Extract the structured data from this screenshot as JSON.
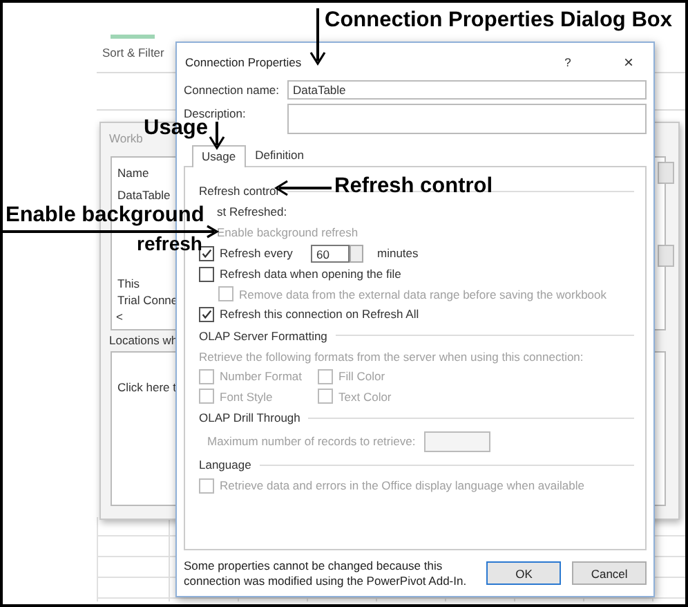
{
  "background": {
    "ribbon_label": "Sort & Filter"
  },
  "back_window": {
    "title": "Workb",
    "list_header": "Name",
    "list_items": [
      {
        "label": "DataTable"
      },
      {
        "label": "This"
      },
      {
        "label": "Trial Conne"
      }
    ],
    "scroll_left": "<",
    "locations_label": "Locations wh",
    "locations_row": "Click here t"
  },
  "dialog": {
    "title": "Connection Properties",
    "help": "?",
    "close": "×",
    "name_label": "Connection name:",
    "name_value": "DataTable",
    "description_label": "Description:",
    "tabs": [
      {
        "label": "Usage",
        "selected": true
      },
      {
        "label": "Definition",
        "selected": false
      }
    ],
    "rows": [
      {
        "kind": "section",
        "text": "Refresh control"
      },
      {
        "kind": "label",
        "text": "st Refreshed:",
        "disabled": false
      },
      {
        "kind": "label",
        "text": "Enable background refresh",
        "disabled": true
      },
      {
        "kind": "spin",
        "label": "Refresh every",
        "checked": true,
        "value": "60",
        "unit": "minutes"
      },
      {
        "kind": "checkbox",
        "label": "Refresh data when opening the file",
        "checked": false,
        "disabled": false,
        "indent": false
      },
      {
        "kind": "checkbox",
        "label": "Remove data from the external data range before saving the workbook",
        "checked": false,
        "disabled": true,
        "indent": true
      },
      {
        "kind": "checkbox",
        "label": "Refresh this connection on Refresh All",
        "checked": true,
        "disabled": false,
        "indent": false
      },
      {
        "kind": "section",
        "text": "OLAP Server Formatting"
      },
      {
        "kind": "text",
        "text": "Retrieve the following formats from the server when using this connection:",
        "disabled": true
      },
      {
        "kind": "pair",
        "items": [
          {
            "label": "Number Format",
            "checked": false
          },
          {
            "label": "Fill Color",
            "checked": false
          }
        ]
      },
      {
        "kind": "pair",
        "items": [
          {
            "label": "Font Style",
            "checked": false
          },
          {
            "label": "Text Color",
            "checked": false
          }
        ]
      },
      {
        "kind": "section",
        "text": "OLAP Drill Through"
      },
      {
        "kind": "field",
        "label": "Maximum number of records to retrieve:"
      },
      {
        "kind": "section",
        "text": "Language"
      },
      {
        "kind": "checkbox",
        "label": "Retrieve data and errors in the Office display language when available",
        "checked": false,
        "disabled": true,
        "indent": false
      }
    ],
    "note": "Some properties cannot be changed because this connection was modified using the PowerPivot Add-In.",
    "buttons": [
      {
        "label": "OK",
        "default": true
      },
      {
        "label": "Cancel",
        "default": false
      }
    ]
  },
  "annotations": [
    {
      "kind": "down",
      "text": "Connection Properties Dialog Box"
    },
    {
      "kind": "down",
      "text": "Usage"
    },
    {
      "kind": "left",
      "text": "Refresh control"
    },
    {
      "kind": "right",
      "text": "Enable background"
    },
    {
      "kind": "none",
      "text": "refresh"
    }
  ]
}
